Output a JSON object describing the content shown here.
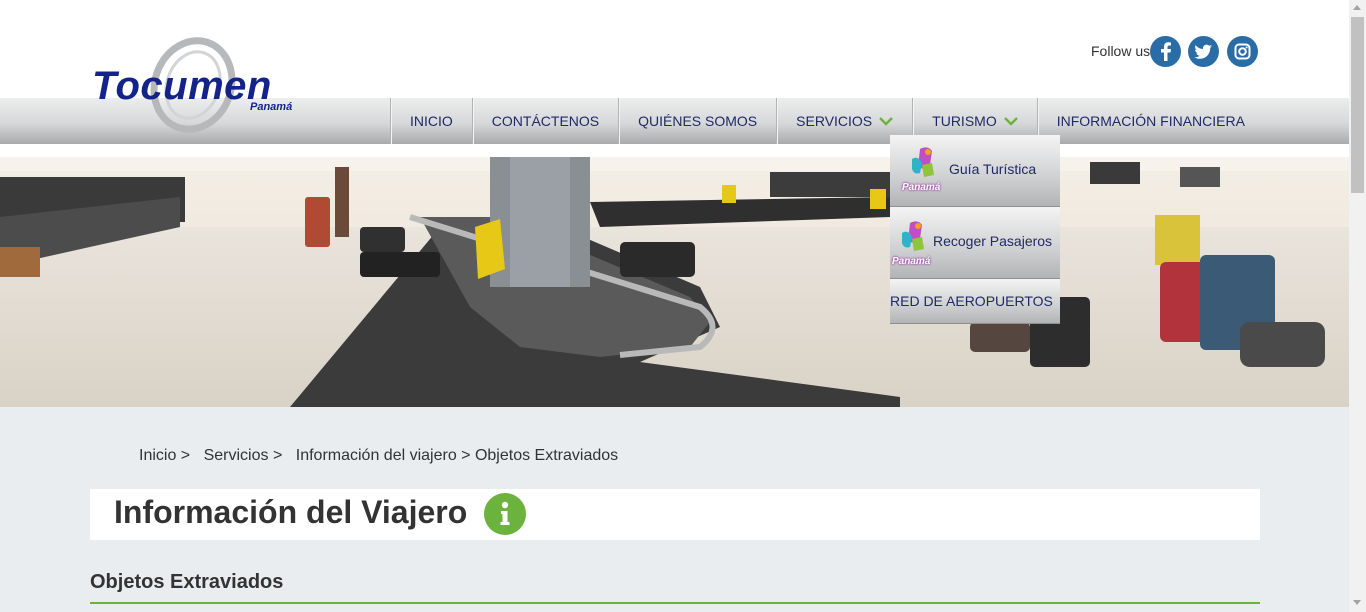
{
  "logo": {
    "name": "Tocumen",
    "subtitle": "Panamá"
  },
  "social": {
    "label": "Follow us",
    "icons": [
      "facebook-icon",
      "twitter-icon",
      "instagram-icon"
    ]
  },
  "nav": {
    "items": [
      {
        "label": "INICIO"
      },
      {
        "label": "CONTÁCTENOS"
      },
      {
        "label": "QUIÉNES SOMOS"
      },
      {
        "label": "SERVICIOS",
        "has_dropdown": true
      },
      {
        "label": "TURISMO",
        "has_dropdown": true
      },
      {
        "label": "INFORMACIÓN FINANCIERA"
      }
    ]
  },
  "dropdown": {
    "items": [
      {
        "label": "Guía Turística",
        "logo_text": "Panamá"
      },
      {
        "label": "Recoger Pasajeros",
        "logo_text": "Panamá"
      },
      {
        "label": "RED DE AEROPUERTOS"
      }
    ]
  },
  "breadcrumb": [
    "Inicio >",
    "Servicios >",
    "Información del viajero > Objetos Extraviados"
  ],
  "main": {
    "title": "Información del Viajero",
    "section_title": "Objetos Extraviados"
  },
  "colors": {
    "brand": "#14238a",
    "accent": "#6cb33e",
    "nav_text": "#1f2a66",
    "social": "#2a6ca5"
  }
}
